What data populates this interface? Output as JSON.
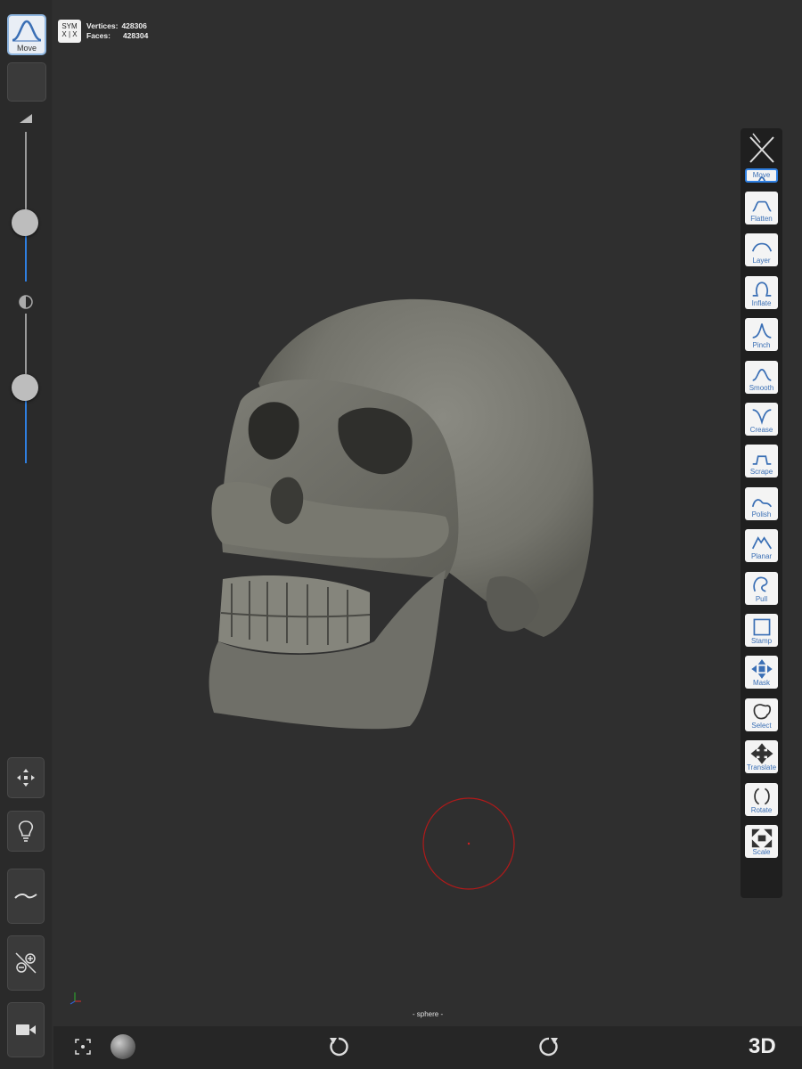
{
  "left_panel": {
    "current_brush_label": "Move"
  },
  "stats": {
    "sym_top": "SYM",
    "sym_bottom": "X | X",
    "vertices_label": "Vertices:",
    "vertices_value": "428306",
    "faces_label": "Faces:",
    "faces_value": "428304"
  },
  "sliders": {
    "radius": 0.39,
    "intensity": 0.52
  },
  "tools": [
    {
      "label": "Move",
      "icon": "move-brush-icon"
    },
    {
      "label": "Flatten",
      "icon": "flatten-brush-icon"
    },
    {
      "label": "Layer",
      "icon": "layer-brush-icon"
    },
    {
      "label": "Inflate",
      "icon": "inflate-brush-icon"
    },
    {
      "label": "Pinch",
      "icon": "pinch-brush-icon"
    },
    {
      "label": "Smooth",
      "icon": "smooth-brush-icon"
    },
    {
      "label": "Crease",
      "icon": "crease-brush-icon"
    },
    {
      "label": "Scrape",
      "icon": "scrape-brush-icon"
    },
    {
      "label": "Polish",
      "icon": "polish-brush-icon"
    },
    {
      "label": "Planar",
      "icon": "planar-brush-icon"
    },
    {
      "label": "Pull",
      "icon": "pull-brush-icon"
    },
    {
      "label": "Stamp",
      "icon": "stamp-brush-icon"
    },
    {
      "label": "Mask",
      "icon": "mask-brush-icon"
    },
    {
      "label": "Select",
      "icon": "select-brush-icon"
    },
    {
      "label": "Translate",
      "icon": "translate-brush-icon"
    },
    {
      "label": "Rotate",
      "icon": "rotate-brush-icon"
    },
    {
      "label": "Scale",
      "icon": "scale-brush-icon"
    }
  ],
  "mesh_name": "- sphere -",
  "bottom_bar": {
    "mode_label": "3D"
  },
  "colors": {
    "accent": "#2f7fe0",
    "model": "#77776f",
    "viewport": "#2f2f2f",
    "cursor_ring": "#b01a1a"
  }
}
